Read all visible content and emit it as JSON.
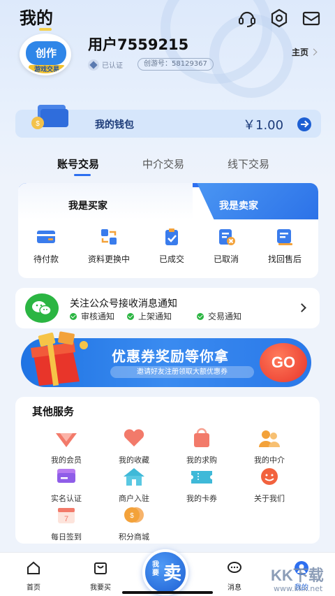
{
  "header": {
    "title": "我的"
  },
  "profile": {
    "username": "用户7559215",
    "verified_label": "已认证",
    "id_chip": "创游号：58129367",
    "home_label": "主页",
    "avatar_text": "创作",
    "avatar_sub": "游戏交易"
  },
  "wallet": {
    "label": "我的钱包",
    "amount": "￥1.00"
  },
  "tabs": [
    "账号交易",
    "中介交易",
    "线下交易"
  ],
  "trade": {
    "buyer_label": "我是买家",
    "seller_label": "我是卖家",
    "items": [
      "待付款",
      "资料更换中",
      "已成交",
      "已取消",
      "找回售后"
    ]
  },
  "notice": {
    "title": "关注公众号接收消息通知",
    "tags": [
      "审核通知",
      "上架通知",
      "交易通知"
    ]
  },
  "banner": {
    "title": "优惠券奖励等你拿",
    "subtitle": "邀请好友注册领取大额优惠券",
    "go": "GO"
  },
  "services": {
    "title": "其他服务",
    "items": [
      "我的会员",
      "我的收藏",
      "我的求购",
      "我的中介",
      "实名认证",
      "商户入驻",
      "我的卡券",
      "关于我们",
      "每日签到",
      "积分商城"
    ]
  },
  "bottom_nav": {
    "items": [
      "首页",
      "我要买",
      "消息",
      "我的"
    ],
    "sell_small": "我要",
    "sell_big": "卖"
  },
  "watermark": {
    "logo": "KK下载",
    "url": "www.kkx.net"
  },
  "colors": {
    "accent": "#2d6ff0",
    "wechat": "#2bb542",
    "go": "#e8352a"
  }
}
